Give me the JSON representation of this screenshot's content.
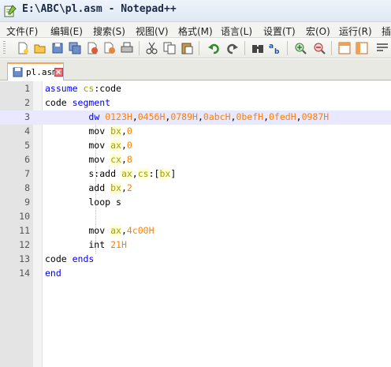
{
  "window": {
    "title": "E:\\ABC\\pl.asm - Notepad++"
  },
  "menu": [
    "文件(F)",
    "编辑(E)",
    "搜索(S)",
    "视图(V)",
    "格式(M)",
    "语言(L)",
    "设置(T)",
    "宏(O)",
    "运行(R)",
    "插"
  ],
  "toolbar": {
    "icons": [
      "new-file-icon",
      "open-file-icon",
      "save-icon",
      "save-all-icon",
      "close-icon",
      "close-all-icon",
      "print-icon",
      "cut-icon",
      "copy-icon",
      "paste-icon",
      "undo-icon",
      "redo-icon",
      "find-icon",
      "replace-icon",
      "zoom-in-icon",
      "zoom-out-icon",
      "sync-vertical-icon",
      "sync-horizontal-icon",
      "word-wrap-icon"
    ]
  },
  "tab": {
    "label": "pl.asm"
  },
  "editor": {
    "current_line": 3,
    "lines": [
      {
        "n": "1",
        "tokens": [
          [
            "kw",
            "assume"
          ],
          [
            "plain",
            " "
          ],
          [
            "reg",
            "cs"
          ],
          [
            "plain",
            ":code"
          ]
        ]
      },
      {
        "n": "2",
        "tokens": [
          [
            "plain",
            "code "
          ],
          [
            "kw",
            "segment"
          ]
        ]
      },
      {
        "n": "3",
        "tokens": [
          [
            "plain",
            "        "
          ],
          [
            "kw",
            "dw"
          ],
          [
            "plain",
            " "
          ],
          [
            "num",
            "0123H"
          ],
          [
            "plain",
            ","
          ],
          [
            "num",
            "0456H"
          ],
          [
            "plain",
            ","
          ],
          [
            "num",
            "0789H"
          ],
          [
            "plain",
            ","
          ],
          [
            "num",
            "0abcH"
          ],
          [
            "plain",
            ","
          ],
          [
            "num",
            "0befH"
          ],
          [
            "plain",
            ","
          ],
          [
            "num",
            "0fedH"
          ],
          [
            "plain",
            ","
          ],
          [
            "num",
            "0987H"
          ]
        ]
      },
      {
        "n": "4",
        "tokens": [
          [
            "plain",
            "        mov "
          ],
          [
            "regbg",
            "bx"
          ],
          [
            "plain",
            ","
          ],
          [
            "num",
            "0"
          ]
        ]
      },
      {
        "n": "5",
        "tokens": [
          [
            "plain",
            "        mov "
          ],
          [
            "regbg",
            "ax"
          ],
          [
            "plain",
            ","
          ],
          [
            "num",
            "0"
          ]
        ]
      },
      {
        "n": "6",
        "tokens": [
          [
            "plain",
            "        mov "
          ],
          [
            "regbg",
            "cx"
          ],
          [
            "plain",
            ","
          ],
          [
            "num",
            "8"
          ]
        ]
      },
      {
        "n": "7",
        "tokens": [
          [
            "plain",
            "        s:add "
          ],
          [
            "regbg",
            "ax"
          ],
          [
            "plain",
            ","
          ],
          [
            "regbg",
            "cs"
          ],
          [
            "plain",
            ":["
          ],
          [
            "regbg",
            "bx"
          ],
          [
            "plain",
            "]"
          ]
        ]
      },
      {
        "n": "8",
        "tokens": [
          [
            "plain",
            "        add "
          ],
          [
            "regbg",
            "bx"
          ],
          [
            "plain",
            ","
          ],
          [
            "num",
            "2"
          ]
        ]
      },
      {
        "n": "9",
        "tokens": [
          [
            "plain",
            "        loop s"
          ]
        ]
      },
      {
        "n": "10",
        "tokens": []
      },
      {
        "n": "11",
        "tokens": [
          [
            "plain",
            "        mov "
          ],
          [
            "regbg",
            "ax"
          ],
          [
            "plain",
            ","
          ],
          [
            "num",
            "4c00H"
          ]
        ]
      },
      {
        "n": "12",
        "tokens": [
          [
            "plain",
            "        int "
          ],
          [
            "num",
            "21H"
          ]
        ]
      },
      {
        "n": "13",
        "tokens": [
          [
            "plain",
            "code "
          ],
          [
            "kw",
            "ends"
          ]
        ]
      },
      {
        "n": "14",
        "tokens": [
          [
            "kw",
            "end"
          ]
        ]
      }
    ]
  }
}
